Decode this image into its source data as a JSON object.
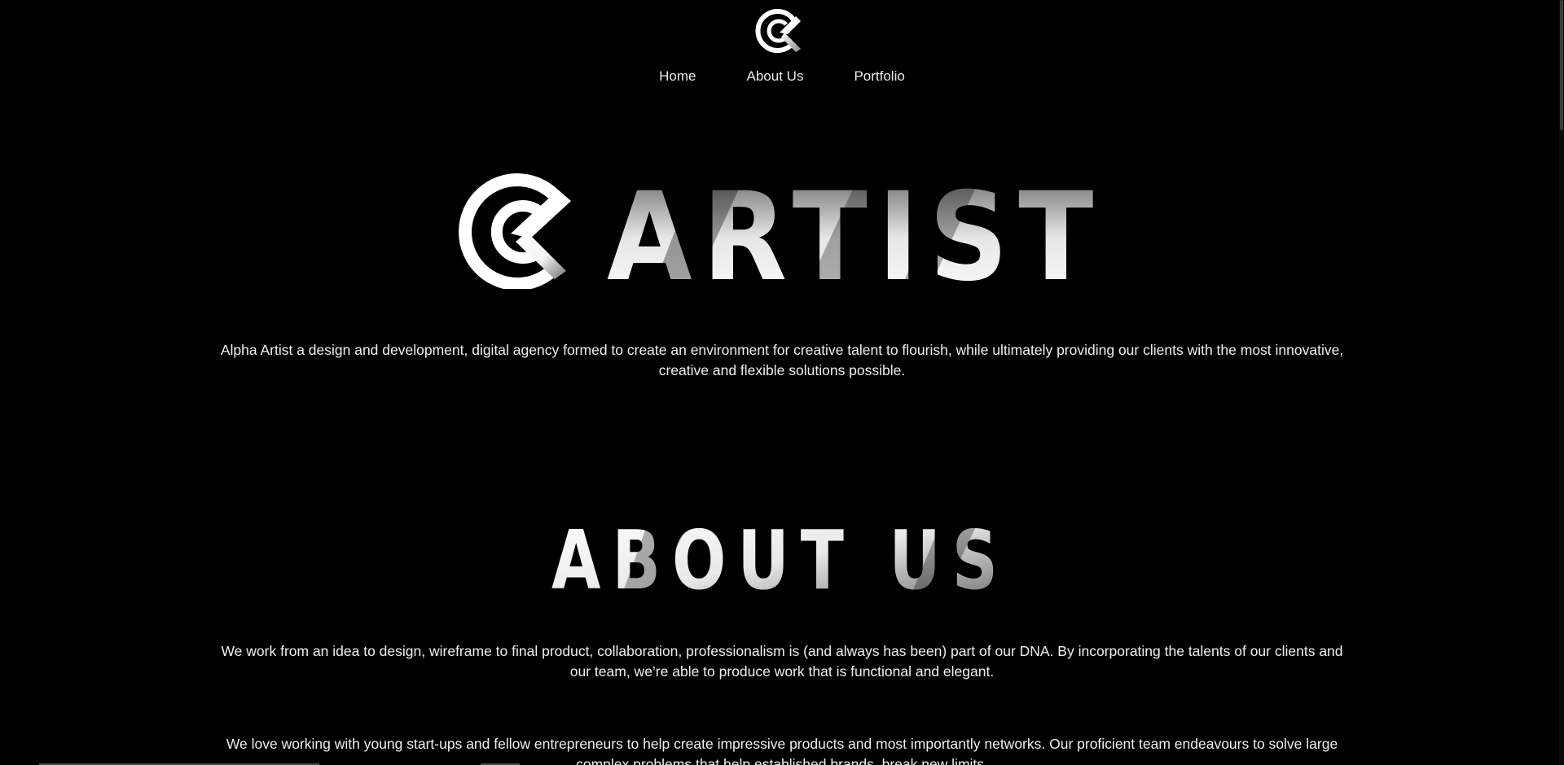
{
  "header": {
    "logo_icon": "alpha-circle-logo-icon",
    "nav": [
      {
        "label": "Home"
      },
      {
        "label": "About Us"
      },
      {
        "label": "Portfolio"
      }
    ]
  },
  "hero": {
    "wordmark_text": "ARTIST",
    "intro_text": "Alpha Artist a design and development, digital agency formed to create an environment for creative talent to flourish, while ultimately providing our clients with the most innovative, creative and flexible solutions possible."
  },
  "about": {
    "heading": "ABOUT US",
    "paragraphs": [
      "We work from an idea to design, wireframe to final product, collaboration, professionalism is (and always has been) part of our DNA. By incorporating the talents of our clients and our team, we’re able to produce work that is functional and elegant.",
      "We love working with young start-ups and fellow entrepreneurs to help create impressive products and most importantly networks. Our proficient team endeavours to solve large complex problems that help established brands, break new limits."
    ]
  },
  "colors": {
    "background": "#000000",
    "text": "#efefef",
    "accent": "#ffffff"
  }
}
